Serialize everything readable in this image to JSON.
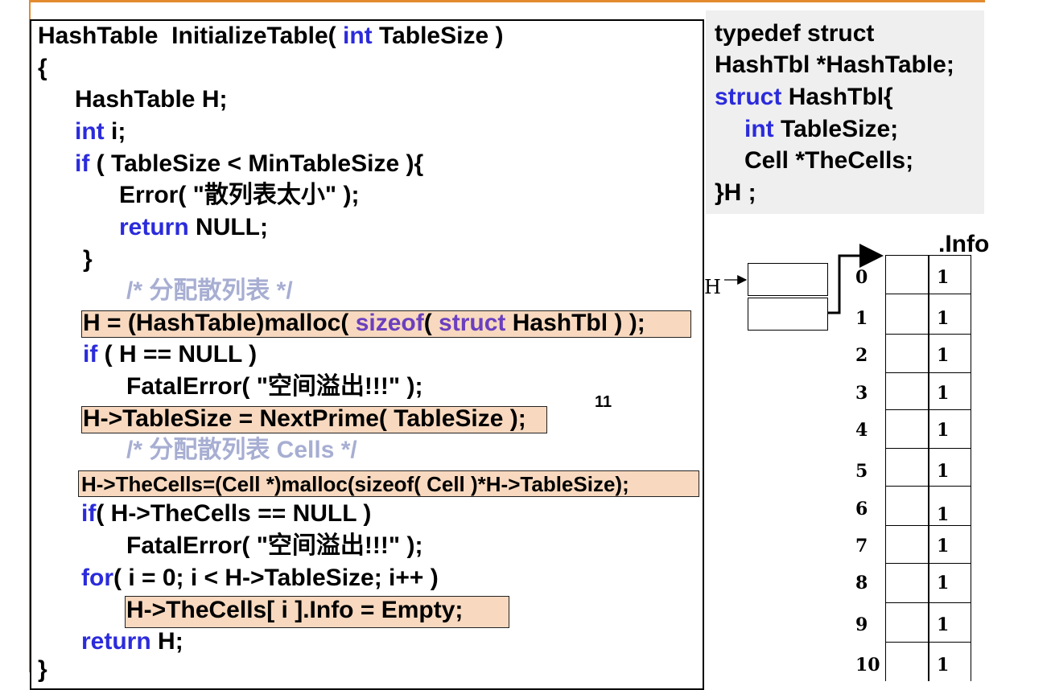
{
  "code": {
    "l1a": "HashTable  InitializeTable( ",
    "l1b": "int",
    "l1c": " TableSize )",
    "l2": "{",
    "l3": "HashTable H;",
    "l4a": "int",
    "l4b": " i;",
    "l5a": "if",
    "l5b": " ( TableSize < MinTableSize ){",
    "l6": "Error( \"散列表太小\" );",
    "l7a": "return",
    "l7b": " NULL;",
    "l8": "}",
    "l9": "/* 分配散列表 */",
    "l10a": "H = (HashTable)malloc( ",
    "l10b": "sizeof",
    "l10c": "( ",
    "l10d": "struct",
    "l10e": " HashTbl ) )",
    "l10f": ";",
    "l11a": "if",
    "l11b": " ( H == NULL )",
    "l12": "FatalError( \"空间溢出!!!\" );",
    "l13a": "H->TableSize = NextPrime( TableSize",
    "l13b": " );",
    "l14": "/* 分配散列表 Cells */",
    "l15a": "H->TheCells=(Cell *)malloc(sizeof( Cell )*H->TableSize)",
    "l15b": ";",
    "l16a": "if",
    "l16b": "( H->TheCells == NULL )",
    "l17": "FatalError( \"空间溢出!!!\" );",
    "l18a": "for",
    "l18b": "( i = 0; i < H->TableSize; i++ )",
    "l19": "H->TheCells[ i ].Info = Empty;",
    "l20a": "return",
    "l20b": " H;",
    "l21": "}"
  },
  "typedef": {
    "t1": "typedef struct",
    "t2": "HashTbl *HashTable;",
    "t3a": "struct",
    "t3b": " HashTbl{",
    "t4a": "int",
    "t4b": " TableSize;",
    "t5": "Cell *TheCells;",
    "t6": "}H ;"
  },
  "annotation": "11",
  "diagram": {
    "info_title": ".Info",
    "h_label": "H",
    "indices": [
      "0",
      "1",
      "2",
      "3",
      "4",
      "5",
      "6",
      "7",
      "8",
      "9",
      "10"
    ],
    "values": [
      "1",
      "1",
      "1",
      "1",
      "1",
      "1",
      "1",
      "1",
      "1",
      "1",
      "1"
    ]
  },
  "colors": {
    "keyword": "#2b2bdb",
    "comment": "#a7aed2",
    "highlight": "#f8d9bf",
    "border_accent": "#e38a2e"
  }
}
